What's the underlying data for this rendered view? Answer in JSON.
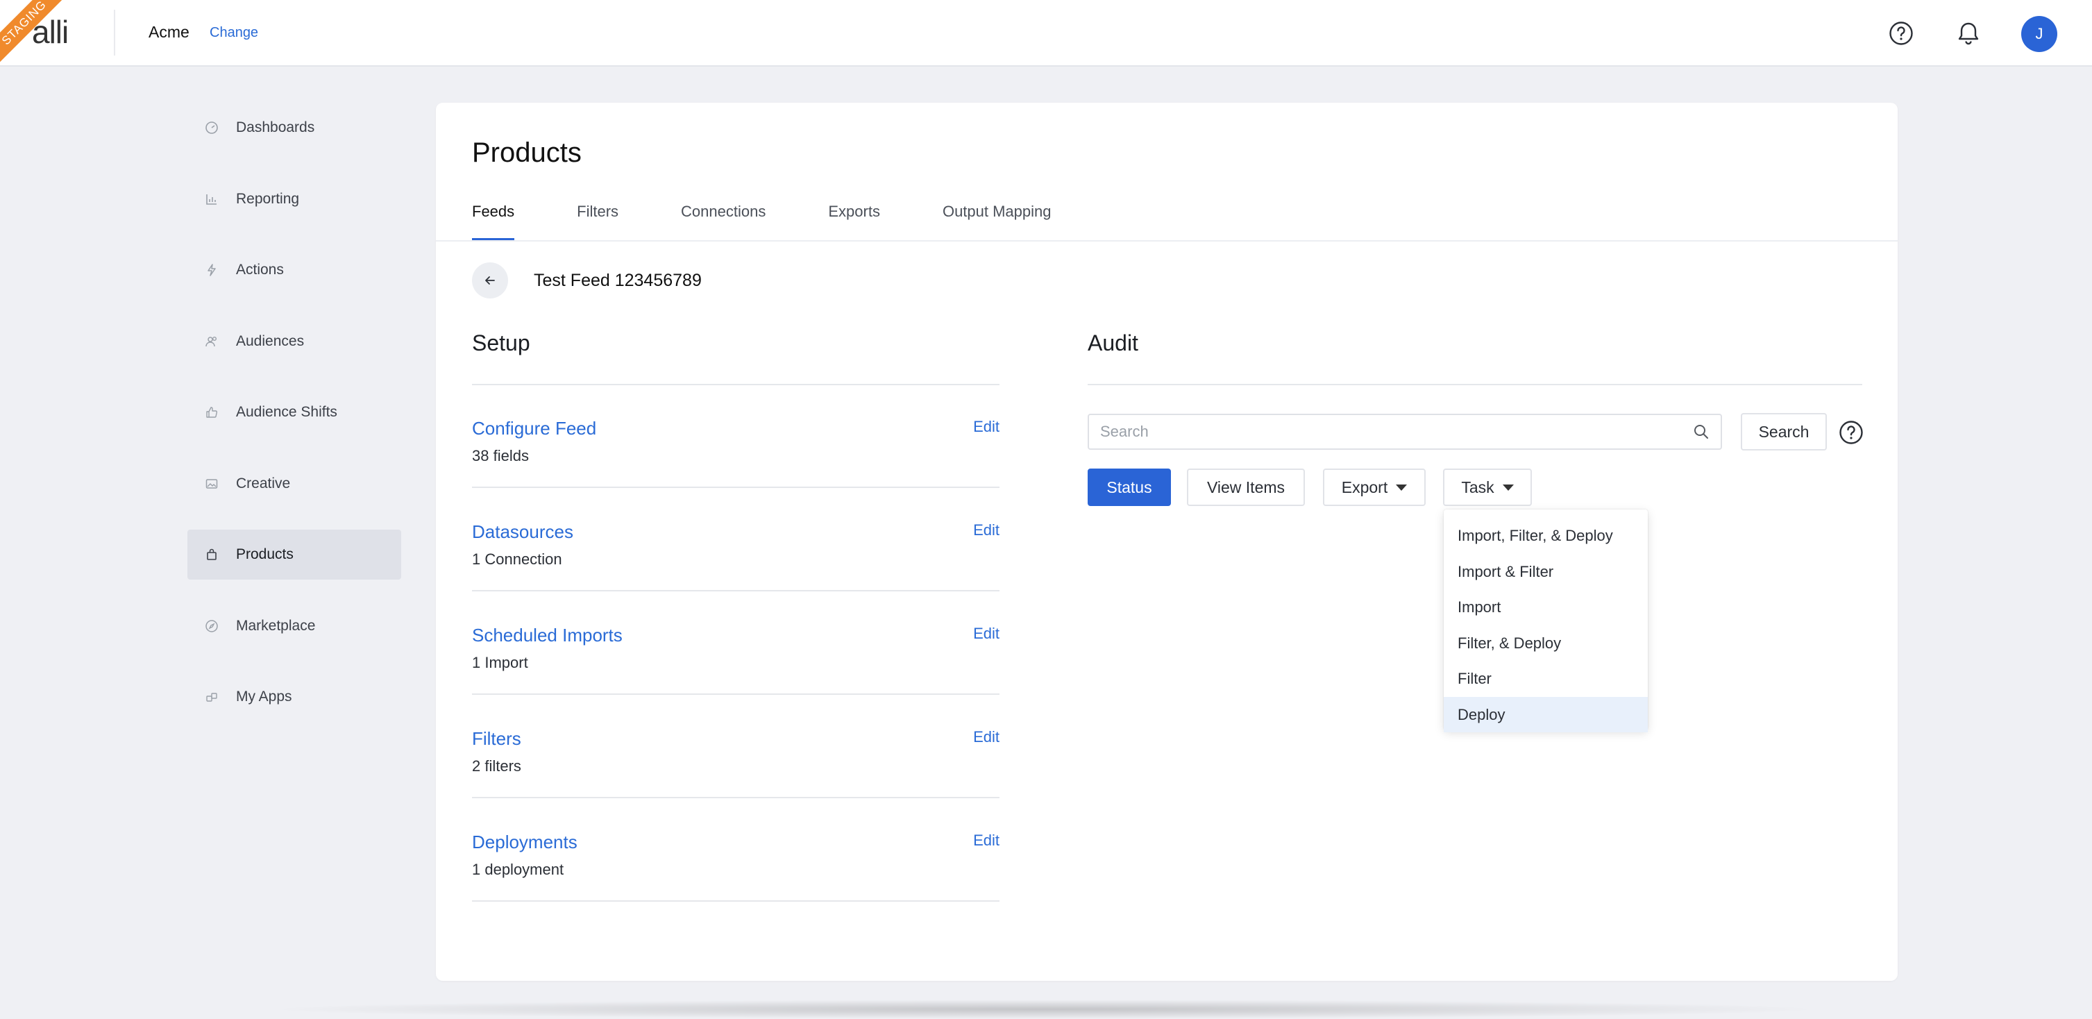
{
  "header": {
    "staging_label": "STAGING",
    "logo_text": "alli",
    "org_name": "Acme",
    "change_label": "Change",
    "avatar_initial": "J"
  },
  "sidebar": {
    "items": [
      {
        "label": "Dashboards",
        "icon": "dashboard-icon"
      },
      {
        "label": "Reporting",
        "icon": "bar-chart-icon"
      },
      {
        "label": "Actions",
        "icon": "lightning-icon"
      },
      {
        "label": "Audiences",
        "icon": "people-icon"
      },
      {
        "label": "Audience Shifts",
        "icon": "thumbs-up-icon"
      },
      {
        "label": "Creative",
        "icon": "image-icon"
      },
      {
        "label": "Products",
        "icon": "shopping-bag-icon",
        "active": true
      },
      {
        "label": "Marketplace",
        "icon": "compass-icon"
      },
      {
        "label": "My Apps",
        "icon": "apps-icon"
      }
    ]
  },
  "main": {
    "title": "Products",
    "tabs": [
      {
        "label": "Feeds",
        "active": true
      },
      {
        "label": "Filters"
      },
      {
        "label": "Connections"
      },
      {
        "label": "Exports"
      },
      {
        "label": "Output Mapping"
      }
    ],
    "feed_name": "Test Feed 123456789",
    "setup": {
      "title": "Setup",
      "items": [
        {
          "title": "Configure Feed",
          "subtitle": "38 fields",
          "edit": "Edit"
        },
        {
          "title": "Datasources",
          "subtitle": "1 Connection",
          "edit": "Edit"
        },
        {
          "title": "Scheduled Imports",
          "subtitle": "1 Import",
          "edit": "Edit"
        },
        {
          "title": "Filters",
          "subtitle": "2 filters",
          "edit": "Edit"
        },
        {
          "title": "Deployments",
          "subtitle": "1 deployment",
          "edit": "Edit"
        }
      ]
    },
    "audit": {
      "title": "Audit",
      "search_placeholder": "Search",
      "search_button": "Search",
      "status_button": "Status",
      "view_items_button": "View Items",
      "export_button": "Export",
      "task_button": "Task",
      "task_menu": [
        {
          "label": "Import, Filter, & Deploy"
        },
        {
          "label": "Import & Filter"
        },
        {
          "label": "Import"
        },
        {
          "label": "Filter, & Deploy"
        },
        {
          "label": "Filter"
        },
        {
          "label": "Deploy",
          "highlighted": true
        }
      ]
    }
  },
  "colors": {
    "accent": "#2a64d6",
    "link": "#2a6bd6",
    "staging": "#f08a2c",
    "page_bg": "#eff0f4",
    "menu_highlight": "#e8f0fb"
  }
}
